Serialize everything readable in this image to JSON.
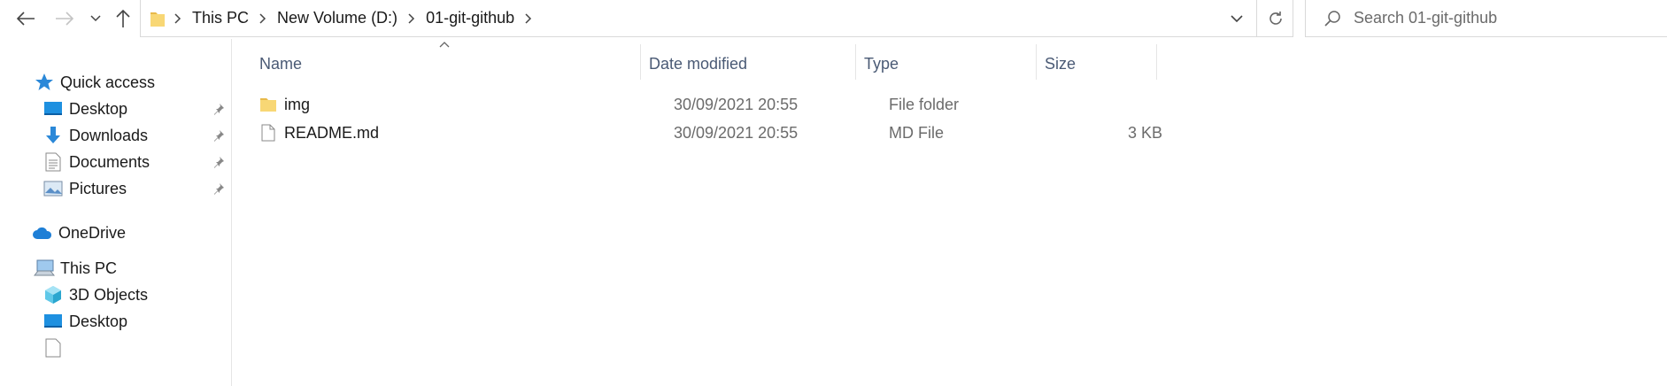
{
  "window": {
    "title": "01-git-github"
  },
  "address_bar": {
    "breadcrumbs": [
      "This PC",
      "New Volume (D:)",
      "01-git-github"
    ]
  },
  "search": {
    "placeholder": "Search 01-git-github"
  },
  "nav_pane": {
    "quick_access": "Quick access",
    "quick_items": [
      {
        "label": "Desktop",
        "icon": "desktop-icon",
        "pinned": true
      },
      {
        "label": "Downloads",
        "icon": "downloads-icon",
        "pinned": true
      },
      {
        "label": "Documents",
        "icon": "documents-icon",
        "pinned": true
      },
      {
        "label": "Pictures",
        "icon": "pictures-icon",
        "pinned": true
      }
    ],
    "onedrive": "OneDrive",
    "this_pc": "This PC",
    "pc_items": [
      {
        "label": "3D Objects",
        "icon": "3d-objects-icon"
      },
      {
        "label": "Desktop",
        "icon": "desktop-icon"
      }
    ]
  },
  "columns": {
    "name": "Name",
    "date": "Date modified",
    "type": "Type",
    "size": "Size"
  },
  "files": [
    {
      "name": "img",
      "date": "30/09/2021 20:55",
      "type": "File folder",
      "size": "",
      "icon": "folder-icon"
    },
    {
      "name": "README.md",
      "date": "30/09/2021 20:55",
      "type": "MD File",
      "size": "3 KB",
      "icon": "file-icon"
    }
  ],
  "colors": {
    "accent": "#0078d4",
    "folder": "#f8d775",
    "header_text": "#4a5a75"
  }
}
